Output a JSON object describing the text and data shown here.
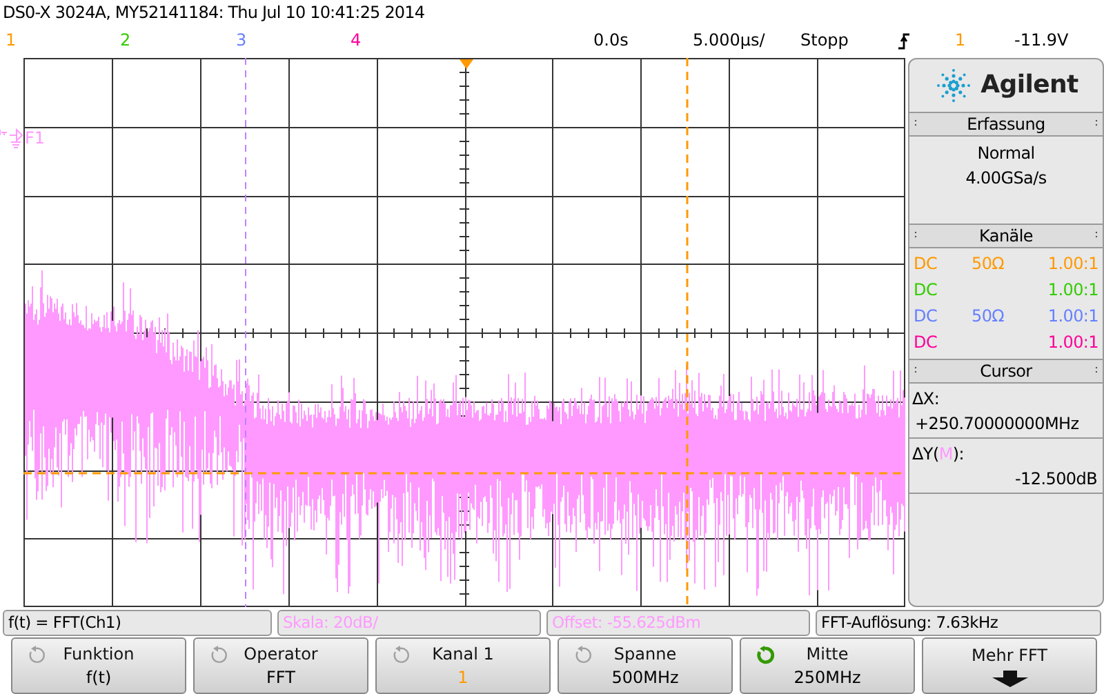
{
  "title": "DS0-X 3024A, MY52141184: Thu Jul 10 10:41:25 2014",
  "channels": [
    {
      "label": "1",
      "color": "#ff9900"
    },
    {
      "label": "2",
      "color": "#33cc00"
    },
    {
      "label": "3",
      "color": "#6680ff"
    },
    {
      "label": "4",
      "color": "#ff0099"
    }
  ],
  "timebase": {
    "delay": "0.0s",
    "scale": "5.000µs/",
    "run_state": "Stopp",
    "trigger_source": "1",
    "trigger_level": "-11.9V"
  },
  "math_marker": "F1",
  "panel": {
    "brand": "Agilent",
    "acquisition": {
      "heading": "Erfassung",
      "mode": "Normal",
      "rate": "4.00GSa/s"
    },
    "channels_heading": "Kanäle",
    "channel_rows": [
      {
        "coupling": "DC",
        "impedance": "50Ω",
        "probe": "1.00:1",
        "color": "#ff9900"
      },
      {
        "coupling": "DC",
        "probe": "1.00:1",
        "color": "#33cc00"
      },
      {
        "coupling": "DC",
        "impedance": "50Ω",
        "probe": "1.00:1",
        "color": "#6680ff"
      },
      {
        "coupling": "DC",
        "probe": "1.00:1",
        "color": "#ff0099"
      }
    ],
    "cursor": {
      "heading": "Cursor",
      "dx_label": "ΔX:",
      "dx_value": "+250.70000000MHz",
      "dy_label": "ΔY(",
      "dy_source": "M",
      "dy_label_end": "):",
      "dy_value": "-12.500dB"
    }
  },
  "info_bar": [
    {
      "text": "f(t) = FFT(Ch1)",
      "color": "#000000"
    },
    {
      "text": "Skala: 20dB/",
      "color": "#ff99ff"
    },
    {
      "text": "Offset: -55.625dBm",
      "color": "#ff99ff"
    },
    {
      "text": "FFT-Auflösung: 7.63kHz",
      "color": "#000000"
    }
  ],
  "softkeys": [
    {
      "label": "Funktion",
      "value": "f(t)",
      "kind": "knob",
      "knob_active": false,
      "color": "#000000"
    },
    {
      "label": "Operator",
      "value": "FFT",
      "kind": "knob",
      "knob_active": false,
      "color": "#000000"
    },
    {
      "label": "Kanal 1",
      "value": "1",
      "kind": "knob",
      "knob_active": false,
      "color": "#ff9900"
    },
    {
      "label": "Spanne",
      "value": "500MHz",
      "kind": "knob",
      "knob_active": false,
      "color": "#000000"
    },
    {
      "label": "Mitte",
      "value": "250MHz",
      "kind": "knob",
      "knob_active": true,
      "color": "#000000"
    },
    {
      "label": "Mehr FFT",
      "kind": "more"
    }
  ]
}
